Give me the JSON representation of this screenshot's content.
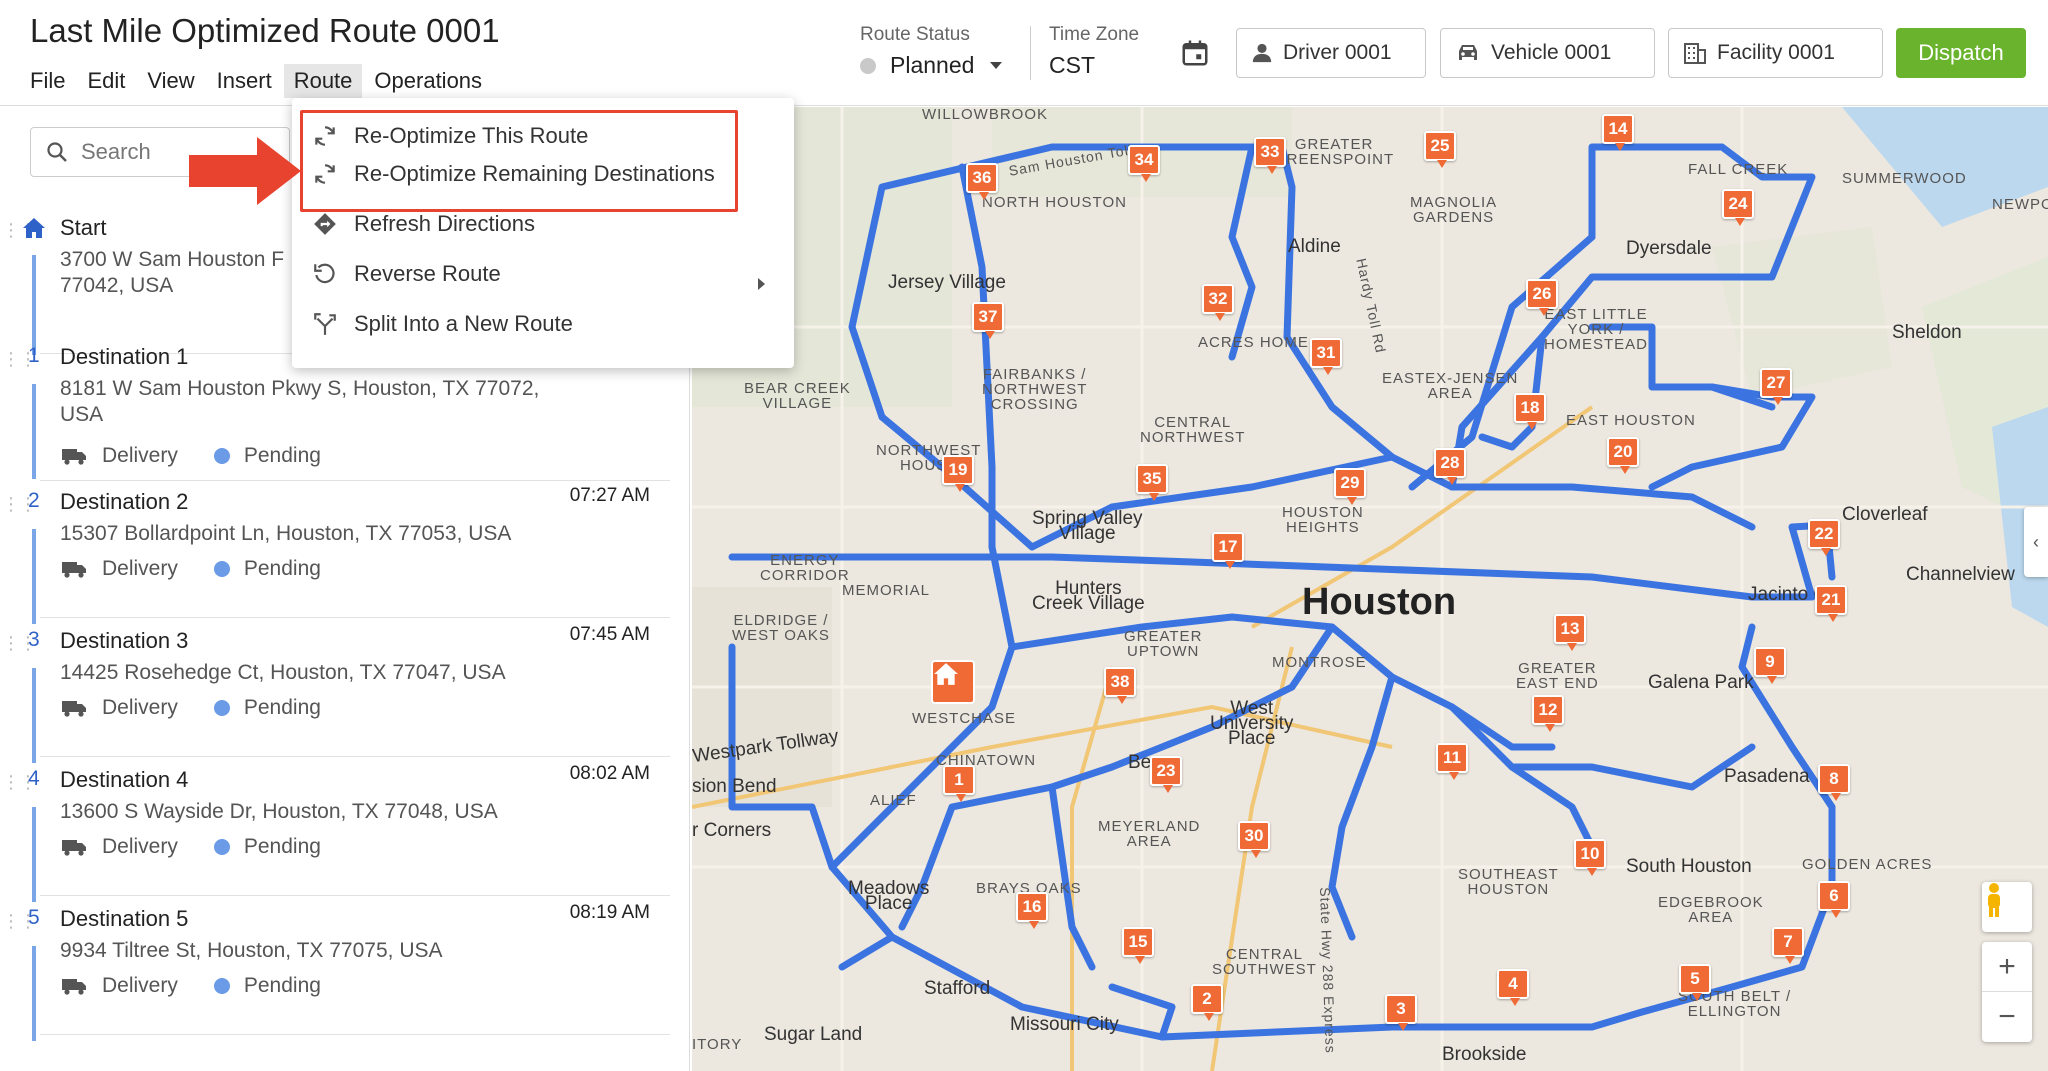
{
  "header": {
    "title": "Last Mile Optimized Route 0001",
    "menu": [
      "File",
      "Edit",
      "View",
      "Insert",
      "Route",
      "Operations"
    ],
    "active_menu": "Route",
    "route_status_label": "Route Status",
    "route_status_value": "Planned",
    "time_zone_label": "Time Zone",
    "time_zone_value": "CST",
    "driver_label": "Driver 0001",
    "vehicle_label": "Vehicle 0001",
    "facility_label": "Facility 0001",
    "dispatch_label": "Dispatch"
  },
  "route_menu": {
    "items": [
      {
        "label": "Re-Optimize This Route",
        "icon": "refresh-cycle-icon"
      },
      {
        "label": "Re-Optimize Remaining Destinations",
        "icon": "refresh-cycle-icon"
      },
      {
        "label": "Refresh Directions",
        "icon": "directions-diamond-icon"
      },
      {
        "label": "Reverse Route",
        "icon": "undo-icon"
      },
      {
        "label": "Split Into a New Route",
        "icon": "split-icon"
      }
    ]
  },
  "sidebar": {
    "search_placeholder": "Search",
    "start": {
      "name": "Start",
      "address": "3700 W Sam Houston F\n77042, USA"
    },
    "stops": [
      {
        "num": "1",
        "name": "Destination 1",
        "time": "",
        "address": "8181 W Sam Houston Pkwy S, Houston, TX 77072, USA",
        "type": "Delivery",
        "status": "Pending"
      },
      {
        "num": "2",
        "name": "Destination 2",
        "time": "07:27 AM",
        "address": "15307 Bollardpoint Ln, Houston, TX 77053, USA",
        "type": "Delivery",
        "status": "Pending"
      },
      {
        "num": "3",
        "name": "Destination 3",
        "time": "07:45 AM",
        "address": "14425 Rosehedge Ct, Houston, TX 77047, USA",
        "type": "Delivery",
        "status": "Pending"
      },
      {
        "num": "4",
        "name": "Destination 4",
        "time": "08:02 AM",
        "address": "13600 S Wayside Dr, Houston, TX 77048, USA",
        "type": "Delivery",
        "status": "Pending"
      },
      {
        "num": "5",
        "name": "Destination 5",
        "time": "08:19 AM",
        "address": "9934 Tiltree St, Houston, TX 77075, USA",
        "type": "Delivery",
        "status": "Pending"
      }
    ]
  },
  "map": {
    "labels": {
      "willowbrook": "WILLOWBROOK",
      "greater_greenspoint": "GREATER\nGREENSPOINT",
      "fall_creek": "FALL CREEK",
      "summerwood": "SUMMERWOOD",
      "newport": "NEWPOR",
      "north_houston": "NORTH HOUSTON",
      "magnolia_gardens": "MAGNOLIA\nGARDENS",
      "aldine": "Aldine",
      "dyersdale": "Dyersdale",
      "jersey_village": "Jersey Village",
      "east_little_york": "EAST LITTLE\nYORK /\nHOMESTEAD",
      "sheldon": "Sheldon",
      "acres_home": "ACRES HOME",
      "fairbanks": "FAIRBANKS /\nNORTHWEST\nCROSSING",
      "bear_creek": "BEAR CREEK\nVILLAGE",
      "eastex": "EASTEX-JENSEN\nAREA",
      "east_houston": "EAST HOUSTON",
      "central_northwest": "CENTRAL\nNORTHWEST",
      "northwest_houston": "NORTHWEST\nHOUST",
      "houston_heights": "HOUSTON\nHEIGHTS",
      "spring_valley": "Spring Valley\nVillage",
      "cloverleaf": "Cloverleaf",
      "energy_corridor": "ENERGY\nCORRIDOR",
      "memorial": "MEMORIAL",
      "channelview": "Channelview",
      "hunters_creek": "Hunters\nCreek Village",
      "houston": "Houston",
      "jacinto_city": "Jacinto City",
      "eldridge": "ELDRIDGE /\nWEST OAKS",
      "greater_uptown": "GREATER\nUPTOWN",
      "montrose": "MONTROSE",
      "greater_east_end": "GREATER\nEAST END",
      "galena_park": "Galena Park",
      "westchase": "WESTCHASE",
      "west_university": "West\nUniversity\nPlace",
      "westpark_tollway": "Westpark Tollway",
      "chinatown": "CHINATOWN",
      "bellaire": "Be",
      "pasadena": "Pasadena",
      "mission_bend": "sion Bend",
      "alief": "ALIEF",
      "four_corners": "r Corners",
      "meyerland": "MEYERLAND\nAREA",
      "southeast_houston": "SOUTHEAST\nHOUSTON",
      "south_houston": "South Houston",
      "golden_acres": "GOLDEN ACRES",
      "meadows_place": "Meadows\nPlace",
      "brays_oaks": "BRAYS OAKS",
      "edgebrook": "EDGEBROOK\nAREA",
      "central_southwest": "CENTRAL\nSOUTHWEST",
      "stafford": "Stafford",
      "missouri_city": "Missouri City",
      "south_belt": "SOUTH BELT /\nELLINGTON",
      "sugar_land": "Sugar Land",
      "itory": "ITORY",
      "brookside": "Brookside",
      "hardy_toll": "Hardy Toll Rd",
      "sam_houston_toll": "Sam Houston Toll",
      "state_hwy_288": "State Hwy 288 Express"
    },
    "markers": [
      "1",
      "2",
      "3",
      "4",
      "5",
      "6",
      "7",
      "8",
      "9",
      "10",
      "11",
      "12",
      "13",
      "14",
      "15",
      "16",
      "17",
      "18",
      "19",
      "20",
      "21",
      "22",
      "23",
      "24",
      "25",
      "26",
      "27",
      "28",
      "29",
      "30",
      "31",
      "32",
      "33",
      "34",
      "35",
      "36",
      "37",
      "38"
    ],
    "zoom_in": "+",
    "zoom_out": "−"
  },
  "colors": {
    "accent": "#6ab42d",
    "route": "#3b74e0",
    "marker": "#ef6a35",
    "highlight": "#e8432f"
  }
}
